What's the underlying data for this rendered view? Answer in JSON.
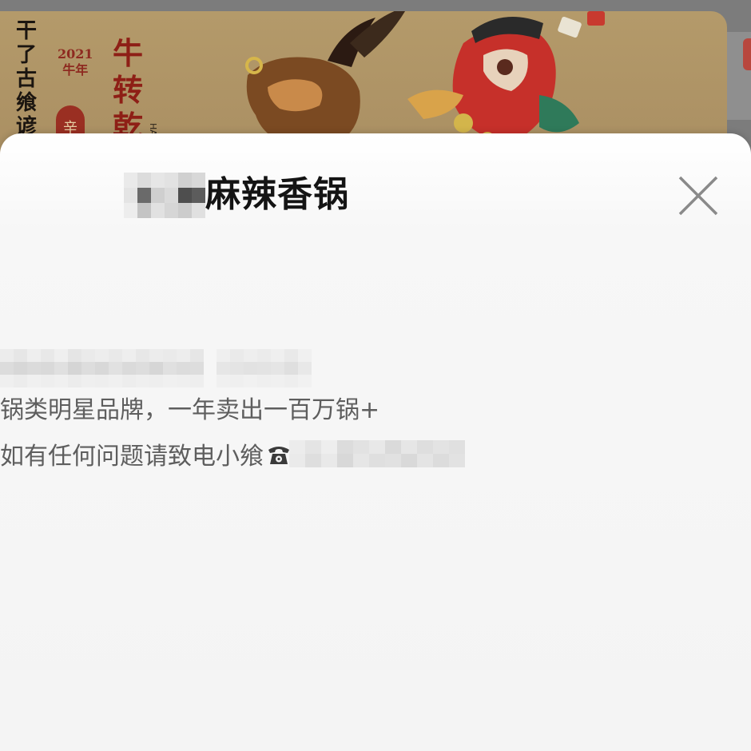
{
  "background": {
    "poster": {
      "vertical_text": "干了古飨谚",
      "year": "2021",
      "year_sub": "牛年",
      "seal": "辛",
      "title": "牛转乾",
      "latin": "HA"
    }
  },
  "sheet": {
    "title": "麻辣香锅",
    "title_prefix_redacted": true,
    "close_icon": "close-icon",
    "name_redacted": true,
    "description": "锅类明星品牌，一年卖出一百万锅+",
    "contact_prefix": "如有任何问题请致电小飨",
    "phone_icon": "telephone-icon",
    "phone_redacted": true
  },
  "colors": {
    "title": "#141414",
    "body_text": "#5e5e5e",
    "close_icon": "#8a8a8a",
    "backdrop": "#7c7c7c"
  }
}
